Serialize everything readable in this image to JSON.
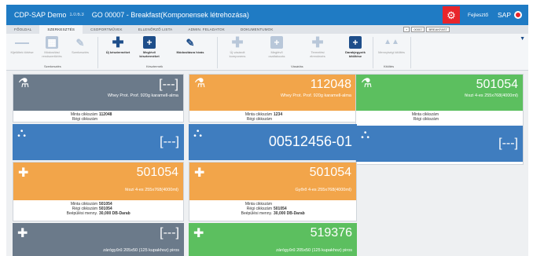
{
  "window": {
    "title": "CDP-SAP Demo",
    "version": "1.0.6.3",
    "document": "GO 00007 - Breakfast(Komponensek létrehozása)",
    "user": "Fejlesztő",
    "sap_label": "SAP",
    "settings_icon": "gear-icon",
    "accent": "#1f7bc4",
    "alert": "#e8252b"
  },
  "tabs": [
    {
      "label": "FŐOLDAL"
    },
    {
      "label": "SZERKESZTÉS",
      "active": true
    },
    {
      "label": "CSOPORTMŰVEK"
    },
    {
      "label": "ELLENŐRZŐ LISTA"
    },
    {
      "label": "ADMIN. FELADATOK"
    },
    {
      "label": "DOKUMENTUMOK"
    }
  ],
  "tab_tools": {
    "plus": "+",
    "code": "00007",
    "name": "BREAKFAST"
  },
  "ribbon": {
    "buttons": [
      {
        "label": "Kijelöltek törlése",
        "icon": "minus-icon",
        "enabled": false
      },
      {
        "label": "Módosítási rendszertörlés",
        "icon": "grid-icon",
        "enabled": false
      },
      {
        "label": "Szerkesztés",
        "icon": "edit-icon",
        "enabled": false
      },
      {
        "label": "Új készterméket",
        "icon": "plus-icon",
        "enabled": true
      },
      {
        "label": "Meglévő készterméket",
        "icon": "add-box-icon",
        "enabled": true
      },
      {
        "label": "Módosításra hívás",
        "icon": "edit-icon",
        "enabled": true
      },
      {
        "label": "Új vásárolt komponens",
        "icon": "plus-icon",
        "enabled": false
      },
      {
        "label": "Meglévő csatlakozás",
        "icon": "add-box-icon",
        "enabled": false
      },
      {
        "label": "Termelési elrendezés",
        "icon": "plus-icon",
        "enabled": false
      },
      {
        "label": "Darabjegyzék kitöltése",
        "icon": "add-box-icon",
        "enabled": true
      },
      {
        "label": "Mennyiségi kitöltés",
        "icon": "tree-icon",
        "enabled": false
      }
    ],
    "groups": [
      "Szerkesztés",
      "Késztermék",
      "Vásárlás",
      "Kitöltés"
    ]
  },
  "cards": [
    {
      "color": "gray",
      "icon": "flask-icon",
      "number": "[---]",
      "desc": "Whey Prot. Prof. 920g karamell-alma",
      "info": [
        [
          "Minta cikkszám",
          "112048"
        ],
        [
          "Régi cikkszám",
          ""
        ]
      ]
    },
    {
      "color": "orange",
      "icon": "flask-icon",
      "number": "112048",
      "desc": "Whey Prot. Prof. 920g karamell-alma",
      "info": [
        [
          "Minta cikkszám",
          "1234"
        ],
        [
          "Régi cikkszám",
          ""
        ]
      ]
    },
    {
      "color": "green",
      "icon": "flask-icon",
      "number": "501054",
      "desc": "fészi 4-es 255x768(4000ml)",
      "info": [
        [
          "Minta cikkszám",
          ""
        ],
        [
          "Régi cikkszám",
          ""
        ]
      ]
    },
    {
      "color": "blue",
      "icon": "tree-icon",
      "number": "[---]"
    },
    {
      "color": "blue",
      "icon": "tree-icon",
      "number": "00512456-01"
    },
    {
      "color": "blue",
      "icon": "tree-icon",
      "number": "[---]"
    },
    {
      "color": "orange",
      "icon": "puzzle-icon",
      "number": "501054",
      "desc": "fészi 4-es 255x768(4000ml)",
      "info": [
        [
          "Minta cikkszám",
          "501054"
        ],
        [
          "Régi cikkszám",
          "501054"
        ],
        [
          "Beépülési menny.",
          "30,000 DB-Darab"
        ]
      ]
    },
    {
      "color": "orange",
      "icon": "puzzle-icon",
      "number": "501054",
      "desc": "Győrő 4-es 255x768(4000ml)",
      "info": [
        [
          "Minta cikkszám",
          ""
        ],
        [
          "Régi cikkszám",
          "501054"
        ],
        [
          "Beépülési menny.",
          "30,000 DB-Darab"
        ]
      ]
    },
    {
      "color": "gray",
      "icon": "puzzle-icon",
      "number": "[---]",
      "desc": "zárógyűrű 205x50 (125 kupakhoz) piros"
    },
    {
      "color": "green",
      "icon": "puzzle-icon",
      "number": "519376",
      "desc": "zárógyűrű 205x50 (125 kupakhoz) piros"
    }
  ]
}
